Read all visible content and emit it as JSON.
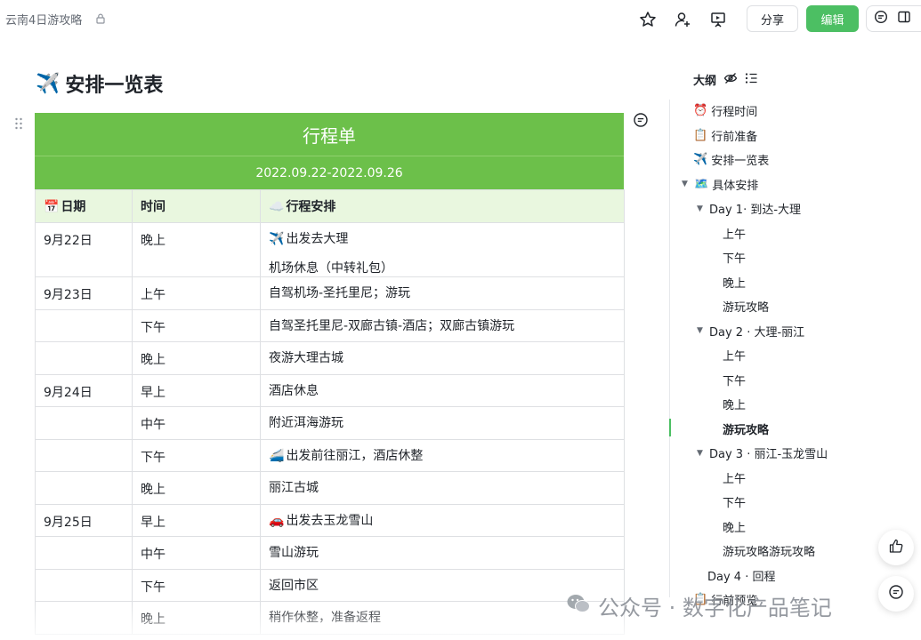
{
  "header": {
    "doc_title": "云南4日游攻略",
    "share_label": "分享",
    "edit_label": "编辑",
    "accent": "#4cbf63"
  },
  "page": {
    "heading_emoji": "✈️",
    "heading": "安排一览表"
  },
  "table": {
    "title": "行程单",
    "subtitle": "2022.09.22-2022.09.26",
    "header_color": "#6cc04a",
    "columns": [
      {
        "emoji": "📅",
        "label": "日期"
      },
      {
        "emoji": "",
        "label": "时间"
      },
      {
        "emoji": "☁️",
        "label": "行程安排"
      }
    ],
    "rows": [
      {
        "date": "9月22日",
        "time": "晚上",
        "plan": [
          {
            "emoji": "✈️",
            "text": "出发去大理"
          },
          {
            "emoji": "",
            "text": "机场休息（中转礼包）"
          }
        ]
      },
      {
        "date": "9月23日",
        "time": "上午",
        "plan": [
          {
            "emoji": "",
            "text": "自驾机场-圣托里尼；游玩"
          }
        ]
      },
      {
        "date": "",
        "time": "下午",
        "plan": [
          {
            "emoji": "",
            "text": "自驾圣托里尼-双廊古镇-酒店；双廊古镇游玩"
          }
        ]
      },
      {
        "date": "",
        "time": "晚上",
        "plan": [
          {
            "emoji": "",
            "text": "夜游大理古城"
          }
        ]
      },
      {
        "date": "9月24日",
        "time": "早上",
        "plan": [
          {
            "emoji": "",
            "text": "酒店休息"
          }
        ]
      },
      {
        "date": "",
        "time": "中午",
        "plan": [
          {
            "emoji": "",
            "text": "附近洱海游玩"
          }
        ]
      },
      {
        "date": "",
        "time": "下午",
        "plan": [
          {
            "emoji": "🚄",
            "text": "出发前往丽江，酒店休整"
          }
        ]
      },
      {
        "date": "",
        "time": "晚上",
        "plan": [
          {
            "emoji": "",
            "text": "丽江古城"
          }
        ]
      },
      {
        "date": "9月25日",
        "time": "早上",
        "plan": [
          {
            "emoji": "🚗",
            "text": "出发去玉龙雪山"
          }
        ]
      },
      {
        "date": "",
        "time": "中午",
        "plan": [
          {
            "emoji": "",
            "text": "雪山游玩"
          }
        ]
      },
      {
        "date": "",
        "time": "下午",
        "plan": [
          {
            "emoji": "",
            "text": "返回市区"
          }
        ]
      },
      {
        "date": "",
        "time": "晚上",
        "plan": [
          {
            "emoji": "",
            "text": "稍作休整，准备返程"
          }
        ]
      }
    ]
  },
  "outline": {
    "title": "大纲",
    "items": [
      {
        "emoji": "⏰",
        "label": "行程时间",
        "caret": "",
        "bold": false
      },
      {
        "emoji": "📋",
        "label": "行前准备",
        "caret": "",
        "bold": false
      },
      {
        "emoji": "✈️",
        "label": "安排一览表",
        "caret": "",
        "bold": false
      },
      {
        "emoji": "🗺️",
        "label": "具体安排",
        "caret": "▼",
        "bold": false
      },
      {
        "emoji": "",
        "label": "Day 1· 到达-大理",
        "caret": "▼",
        "bold": false
      },
      {
        "emoji": "",
        "label": "上午",
        "caret": "",
        "bold": false
      },
      {
        "emoji": "",
        "label": "下午",
        "caret": "",
        "bold": false
      },
      {
        "emoji": "",
        "label": "晚上",
        "caret": "",
        "bold": false
      },
      {
        "emoji": "",
        "label": "游玩攻略",
        "caret": "",
        "bold": false
      },
      {
        "emoji": "",
        "label": "Day 2 · 大理-丽江",
        "caret": "▼",
        "bold": false
      },
      {
        "emoji": "",
        "label": "上午",
        "caret": "",
        "bold": false
      },
      {
        "emoji": "",
        "label": "下午",
        "caret": "",
        "bold": false
      },
      {
        "emoji": "",
        "label": "晚上",
        "caret": "",
        "bold": false
      },
      {
        "emoji": "",
        "label": "游玩攻略",
        "caret": "",
        "bold": true
      },
      {
        "emoji": "",
        "label": "Day 3 · 丽江-玉龙雪山",
        "caret": "▼",
        "bold": false
      },
      {
        "emoji": "",
        "label": "上午",
        "caret": "",
        "bold": false
      },
      {
        "emoji": "",
        "label": "下午",
        "caret": "",
        "bold": false
      },
      {
        "emoji": "",
        "label": "晚上",
        "caret": "",
        "bold": false
      },
      {
        "emoji": "",
        "label": "游玩攻略游玩攻略",
        "caret": "",
        "bold": false
      },
      {
        "emoji": "",
        "label": "Day 4 · 回程",
        "caret": "",
        "bold": false
      },
      {
        "emoji": "📋",
        "label": "行前预览",
        "caret": "",
        "bold": false
      }
    ]
  },
  "watermark": {
    "text": "公众号 · 数字化产品笔记"
  }
}
